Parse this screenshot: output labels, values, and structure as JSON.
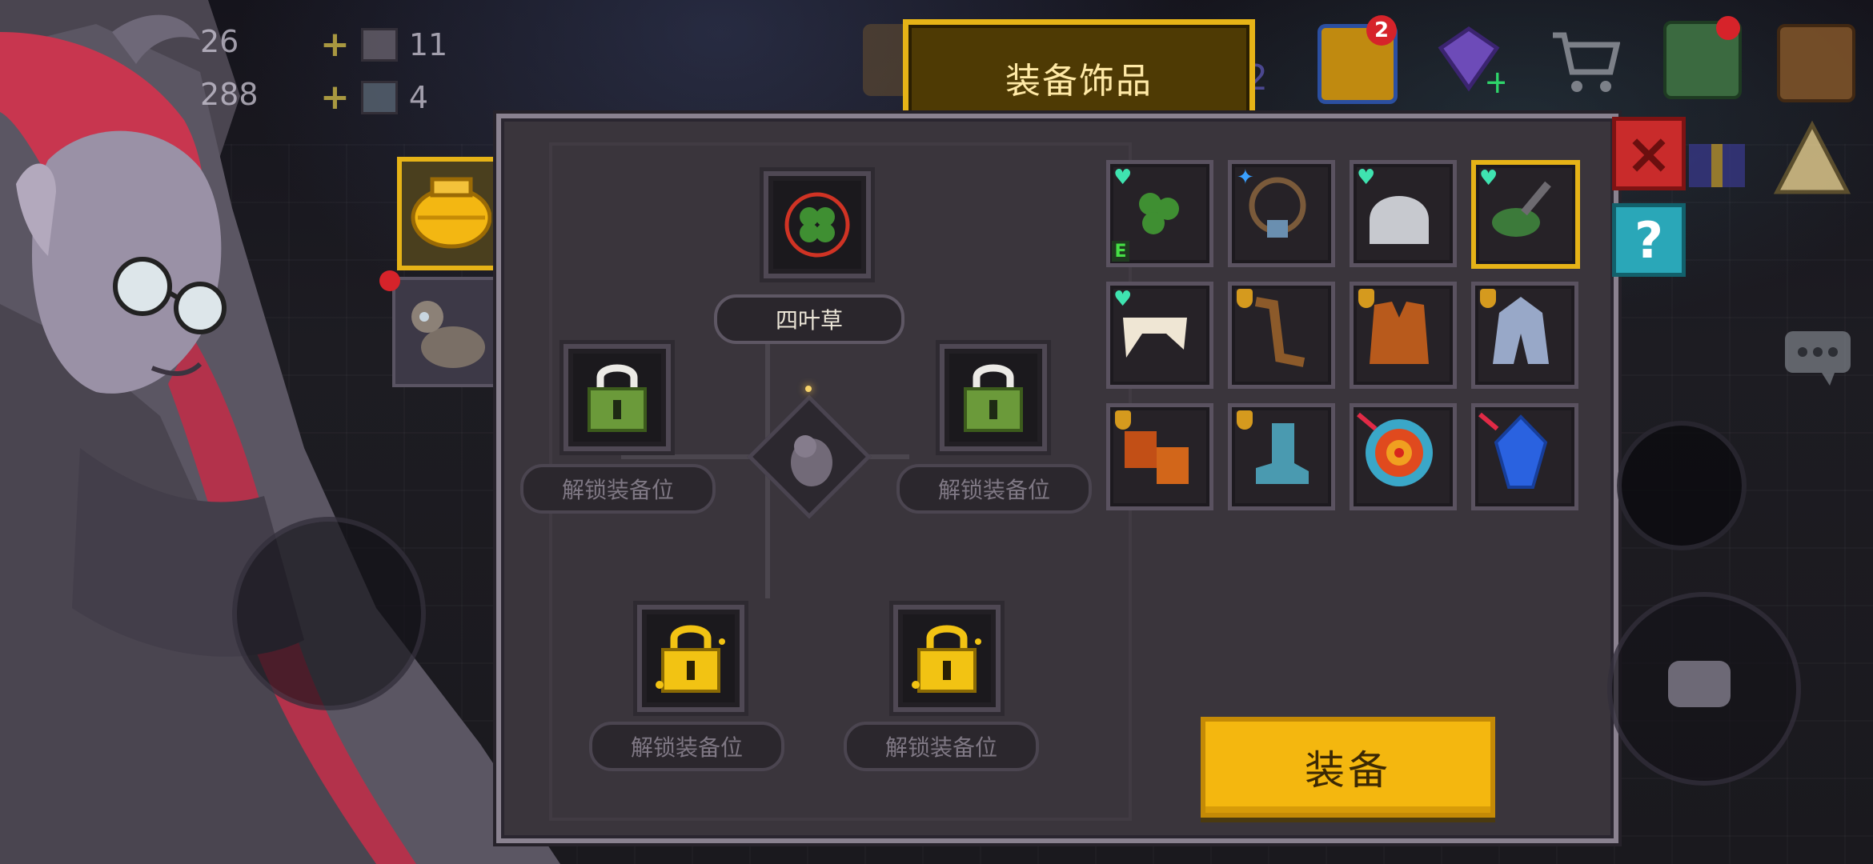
{
  "hud": {
    "stat1": "26",
    "stat2": "288",
    "material1_count": "11",
    "material2_count": "4",
    "plus_icon": "+"
  },
  "top_bar": {
    "mail_badge": "2",
    "partial_number": "2"
  },
  "panel": {
    "title": "装备饰品",
    "active_slot_label": "四叶草",
    "locked_slot_labels": [
      "解锁装备位",
      "解锁装备位",
      "解锁装备位",
      "解锁装备位"
    ],
    "equip_button_label": "装备"
  },
  "inventory": {
    "items": [
      {
        "name": "four-leaf-clover",
        "marker": "heart",
        "tag": "E",
        "selected": false
      },
      {
        "name": "fang-necklace",
        "marker": "blue-star",
        "selected": false
      },
      {
        "name": "ghost-helmet",
        "marker": "heart",
        "selected": false
      },
      {
        "name": "green-frog-statue",
        "marker": "heart",
        "selected": true
      },
      {
        "name": "bone-horn",
        "marker": "heart",
        "selected": false
      },
      {
        "name": "wooden-boomerang",
        "marker": "shield",
        "selected": false
      },
      {
        "name": "orange-vest",
        "marker": "shield",
        "selected": false
      },
      {
        "name": "steel-armor",
        "marker": "shield",
        "selected": false
      },
      {
        "name": "lava-gloves",
        "marker": "shield",
        "selected": false
      },
      {
        "name": "ice-boots",
        "marker": "shield",
        "selected": false
      },
      {
        "name": "target-shield",
        "marker": "red-slash",
        "selected": false
      },
      {
        "name": "blue-gem",
        "marker": "red-slash",
        "selected": false
      }
    ]
  },
  "colors": {
    "accent_gold": "#e6b317",
    "panel_bg": "#3a353c",
    "button_yellow": "#f4b70f",
    "close_red": "#c92b2b",
    "help_teal": "#2aa7b8",
    "marker_heart": "#3fe3b0"
  }
}
